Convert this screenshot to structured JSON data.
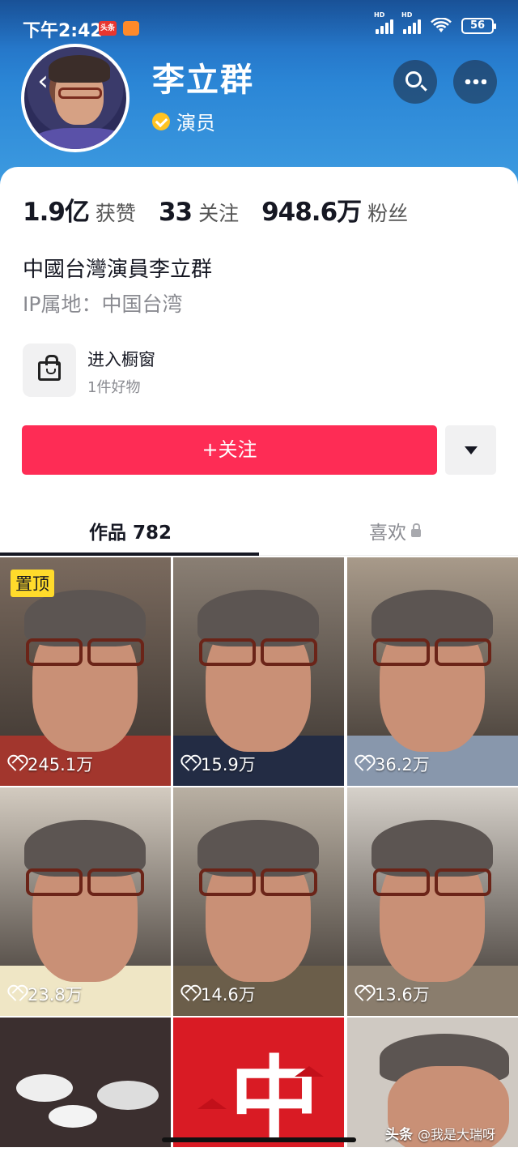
{
  "status_bar": {
    "time": "下午2:42",
    "app_badge": "头条",
    "battery": "56",
    "signal_label": "HD"
  },
  "profile": {
    "name": "李立群",
    "verified_label": "演员",
    "stats": [
      {
        "value": "1.9亿",
        "label": "获赞"
      },
      {
        "value": "33",
        "label": "关注"
      },
      {
        "value": "948.6万",
        "label": "粉丝"
      }
    ],
    "bio": "中國台灣演員李立群",
    "ip_location": "IP属地：中国台湾",
    "shop": {
      "title": "进入橱窗",
      "subtitle": "1件好物"
    },
    "follow_label": "+关注"
  },
  "tabs": {
    "works": "作品 782",
    "likes": "喜欢"
  },
  "videos": [
    {
      "likes": "245.1万",
      "pinned": "置顶",
      "bg": "#7a6a5e",
      "shirt": "#a2362d"
    },
    {
      "likes": "15.9万",
      "bg": "#8a7f74",
      "shirt": "#232c44"
    },
    {
      "likes": "36.2万",
      "bg": "#a89a8a",
      "shirt": "#8897ac"
    },
    {
      "likes": "23.8万",
      "bg": "#d3cbc0",
      "shirt": "#efe6c5"
    },
    {
      "likes": "14.6万",
      "bg": "#b9b0a3",
      "shirt": "#6b5e4a"
    },
    {
      "likes": "13.6万",
      "bg": "#d6d1ca",
      "shirt": "#8a7d6d"
    }
  ],
  "bottom_tiles": {
    "middle_char": "中"
  },
  "watermark": {
    "brand": "头条",
    "handle": "@我是大瑞呀"
  },
  "colors": {
    "accent": "#fe2c55",
    "verify": "#ffc322",
    "pin": "#ffdb2b"
  }
}
